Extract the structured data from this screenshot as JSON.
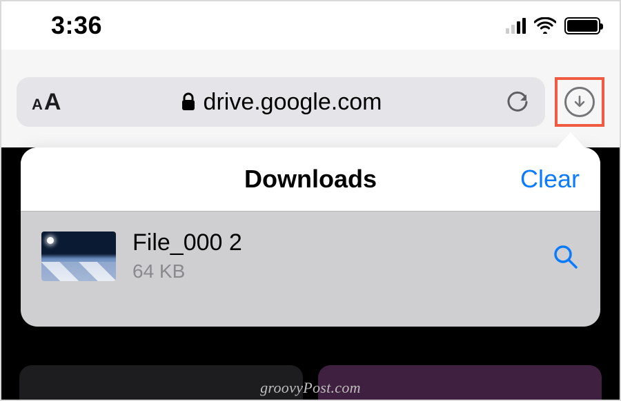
{
  "statusbar": {
    "time": "3:36"
  },
  "address": {
    "url": "drive.google.com"
  },
  "popover": {
    "title": "Downloads",
    "clear_label": "Clear"
  },
  "download": {
    "name": "File_000 2",
    "size": "64 KB"
  },
  "icons": {
    "text_size": "aA",
    "lock": "lock-icon",
    "reload": "reload-icon",
    "downloads": "download-circle-icon",
    "cellular": "cellular-icon",
    "wifi": "wifi-icon",
    "battery": "battery-icon",
    "magnifier": "search-icon"
  },
  "watermark": "groovyPost.com",
  "colors": {
    "highlight_box": "#ef5a41",
    "link_blue": "#0a7aff"
  }
}
